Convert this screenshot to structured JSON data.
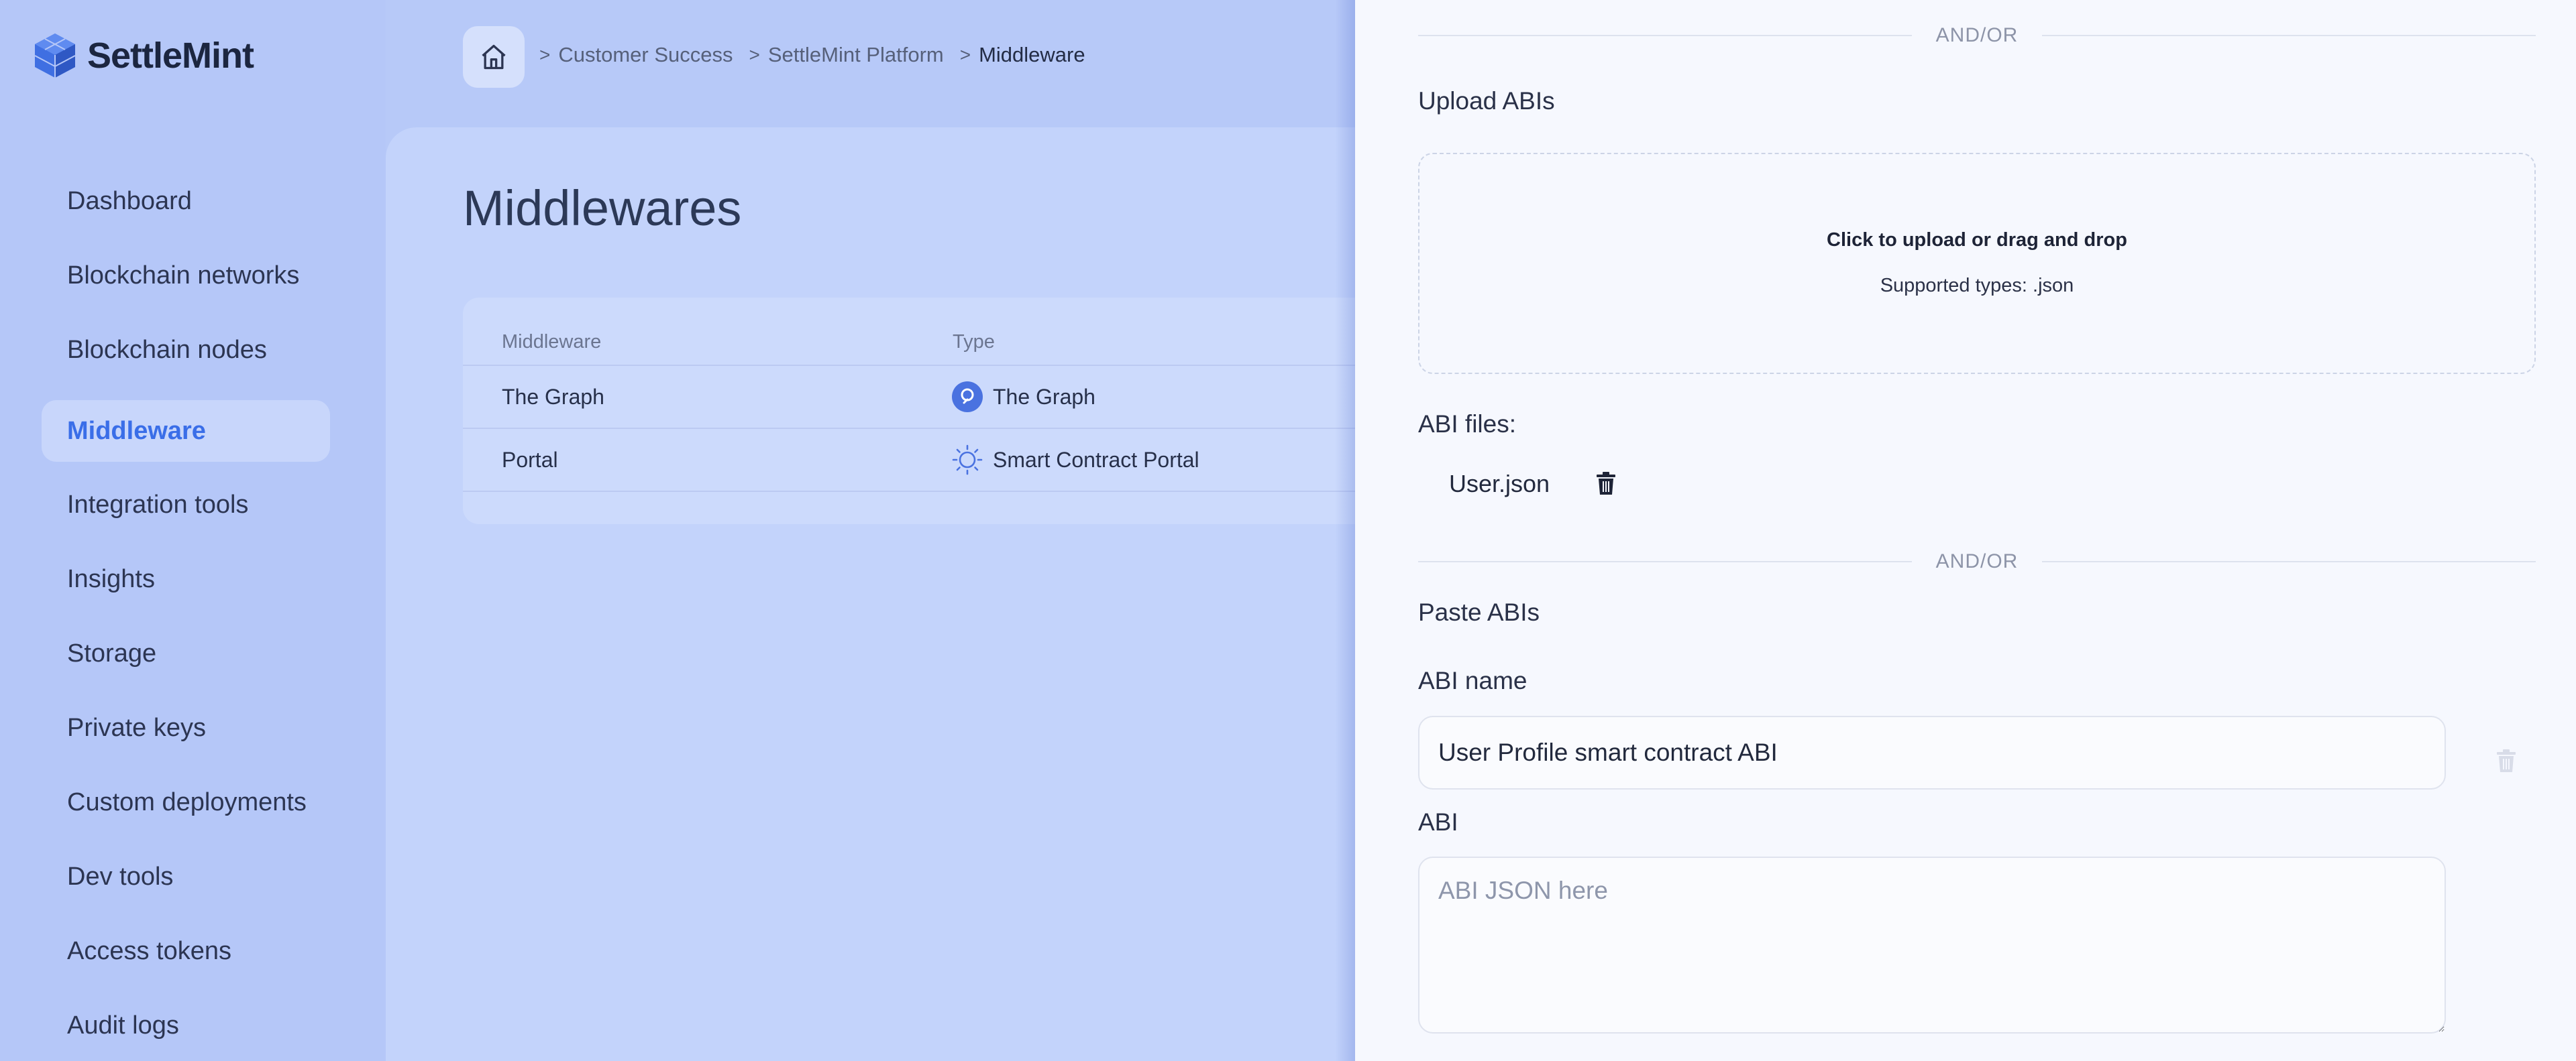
{
  "app": {
    "brand": "SettleMint"
  },
  "colors": {
    "accent": "#3a6ee8",
    "sidebar_bg": "#b5c7f8",
    "drawer_bg": "#f6f8fe"
  },
  "sidebar": {
    "items": [
      {
        "label": "Dashboard"
      },
      {
        "label": "Blockchain networks"
      },
      {
        "label": "Blockchain nodes"
      },
      {
        "label": "Middleware",
        "active": true
      },
      {
        "label": "Integration tools"
      },
      {
        "label": "Insights"
      },
      {
        "label": "Storage"
      },
      {
        "label": "Private keys"
      },
      {
        "label": "Custom deployments"
      },
      {
        "label": "Dev tools"
      },
      {
        "label": "Access tokens"
      },
      {
        "label": "Audit logs"
      }
    ]
  },
  "breadcrumb": {
    "separator": ">",
    "items": [
      "Customer Success",
      "SettleMint Platform",
      "Middleware"
    ]
  },
  "page": {
    "title": "Middlewares"
  },
  "table": {
    "headers": [
      "Middleware",
      "Type"
    ],
    "rows": [
      {
        "name": "The Graph",
        "type": "The Graph",
        "type_icon": "the-graph-icon"
      },
      {
        "name": "Portal",
        "type": "Smart Contract Portal",
        "type_icon": "portal-icon"
      }
    ]
  },
  "drawer": {
    "divider_label": "AND/OR",
    "upload": {
      "label": "Upload ABIs",
      "dropzone_title": "Click to upload or drag and drop",
      "dropzone_subtitle": "Supported types: .json"
    },
    "abi_files": {
      "label": "ABI files:",
      "files": [
        "User.json"
      ]
    },
    "paste": {
      "label": "Paste ABIs",
      "abi_name_label": "ABI name",
      "abi_name_value": "User Profile smart contract ABI",
      "abi_label": "ABI",
      "abi_placeholder": "ABI JSON here"
    }
  }
}
